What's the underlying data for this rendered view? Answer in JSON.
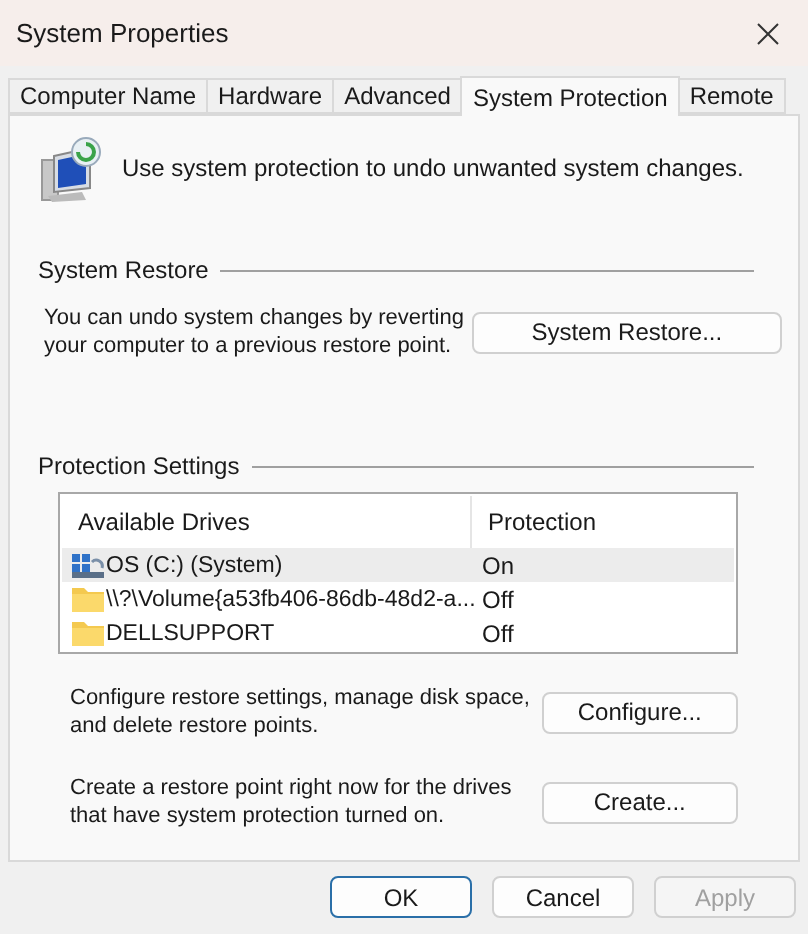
{
  "window": {
    "title": "System Properties"
  },
  "tabs": [
    {
      "label": "Computer Name",
      "selected": false
    },
    {
      "label": "Hardware",
      "selected": false
    },
    {
      "label": "Advanced",
      "selected": false
    },
    {
      "label": "System Protection",
      "selected": true
    },
    {
      "label": "Remote",
      "selected": false
    }
  ],
  "intro": "Use system protection to undo unwanted system changes.",
  "system_restore": {
    "heading": "System Restore",
    "text": "You can undo system changes by reverting your computer to a previous restore point.",
    "button": "System Restore..."
  },
  "protection_settings": {
    "heading": "Protection Settings",
    "columns": [
      "Available Drives",
      "Protection"
    ],
    "rows": [
      {
        "kind": "system",
        "drive": "OS (C:) (System)",
        "protection": "On",
        "selected": true
      },
      {
        "kind": "folder",
        "drive": "\\\\?\\Volume{a53fb406-86db-48d2-a...",
        "protection": "Off",
        "selected": false
      },
      {
        "kind": "folder",
        "drive": "DELLSUPPORT",
        "protection": "Off",
        "selected": false
      }
    ],
    "actions": [
      {
        "text": "Configure restore settings, manage disk space, and delete restore points.",
        "button": "Configure..."
      },
      {
        "text": "Create a restore point right now for the drives that have system protection turned on.",
        "button": "Create..."
      }
    ]
  },
  "buttons": [
    {
      "label": "OK",
      "default": true,
      "disabled": false
    },
    {
      "label": "Cancel",
      "default": false,
      "disabled": false
    },
    {
      "label": "Apply",
      "default": false,
      "disabled": true
    }
  ]
}
